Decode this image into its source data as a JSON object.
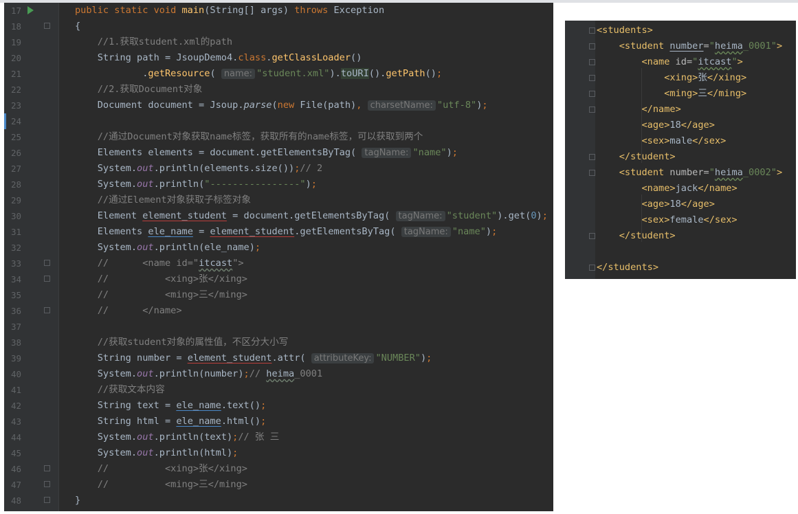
{
  "editor": {
    "lines": [
      {
        "n": "17",
        "segs": [
          [
            "kw",
            "public static void "
          ],
          [
            "fn",
            "main"
          ],
          [
            "",
            "(String[] args) "
          ],
          [
            "kw",
            "throws "
          ],
          [
            "",
            "Exception"
          ]
        ]
      },
      {
        "n": "18",
        "segs": [
          [
            "",
            "{"
          ]
        ]
      },
      {
        "n": "19",
        "segs": [
          [
            "",
            "    "
          ],
          [
            "cm",
            "//1.获取student.xml的path"
          ]
        ]
      },
      {
        "n": "20",
        "segs": [
          [
            "",
            "    String path = JsoupDemo4."
          ],
          [
            "kw",
            "class"
          ],
          [
            "",
            "."
          ],
          [
            "fn",
            "getClassLoader"
          ],
          [
            "",
            "()"
          ]
        ]
      },
      {
        "n": "21",
        "segs": [
          [
            "",
            "            ."
          ],
          [
            "fn",
            "getResource"
          ],
          [
            "",
            "( "
          ],
          [
            "hint",
            "name:"
          ],
          [
            "str",
            "\"student.xml\""
          ],
          [
            "",
            ")."
          ],
          [
            "hl",
            "toURI"
          ],
          [
            "",
            "()."
          ],
          [
            "fn",
            "getPath"
          ],
          [
            "",
            "()"
          ],
          [
            "kw",
            ";"
          ]
        ]
      },
      {
        "n": "22",
        "segs": [
          [
            "",
            "    "
          ],
          [
            "cm",
            "//2.获取Document对象"
          ]
        ]
      },
      {
        "n": "23",
        "segs": [
          [
            "",
            "    Document document = Jsoup."
          ],
          [
            "st",
            "parse"
          ],
          [
            "",
            "("
          ],
          [
            "kw",
            "new "
          ],
          [
            "",
            "File(path)"
          ],
          [
            "kw",
            ", "
          ],
          [
            "hint",
            "charsetName:"
          ],
          [
            "str",
            "\"utf-8\""
          ],
          [
            "",
            ")"
          ],
          [
            "kw",
            ";"
          ]
        ]
      },
      {
        "n": "24",
        "segs": []
      },
      {
        "n": "25",
        "segs": [
          [
            "",
            "    "
          ],
          [
            "cm",
            "//通过Document对象获取name标签，获取所有的name标签，可以获取到两个"
          ]
        ]
      },
      {
        "n": "26",
        "segs": [
          [
            "",
            "    Elements elements = document.getElementsByTag( "
          ],
          [
            "hint",
            "tagName:"
          ],
          [
            "str",
            "\"name\""
          ],
          [
            "",
            ")"
          ],
          [
            "kw",
            ";"
          ]
        ]
      },
      {
        "n": "27",
        "segs": [
          [
            "",
            "    System."
          ],
          [
            "it",
            "out"
          ],
          [
            "",
            ".println(elements.size())"
          ],
          [
            "kw",
            ";"
          ],
          [
            "cm",
            "// 2"
          ]
        ]
      },
      {
        "n": "28",
        "segs": [
          [
            "",
            "    System."
          ],
          [
            "it",
            "out"
          ],
          [
            "",
            ".println("
          ],
          [
            "str",
            "\"----------------\""
          ],
          [
            "",
            ")"
          ],
          [
            "kw",
            ";"
          ]
        ]
      },
      {
        "n": "29",
        "segs": [
          [
            "",
            "    "
          ],
          [
            "cm",
            "//通过Element对象获取子标签对象"
          ]
        ]
      },
      {
        "n": "30",
        "segs": [
          [
            "",
            "    Element "
          ],
          [
            "ur",
            "element_student"
          ],
          [
            "",
            " = document.getElementsByTag( "
          ],
          [
            "hint",
            "tagName:"
          ],
          [
            "str",
            "\"student\""
          ],
          [
            "",
            ").get("
          ],
          [
            "num",
            "0"
          ],
          [
            "",
            ")"
          ],
          [
            "kw",
            ";"
          ]
        ]
      },
      {
        "n": "31",
        "segs": [
          [
            "",
            "    Elements "
          ],
          [
            "ub",
            "ele_name"
          ],
          [
            "",
            " = "
          ],
          [
            "ur",
            "element_student"
          ],
          [
            "",
            ".getElementsByTag( "
          ],
          [
            "hint",
            "tagName:"
          ],
          [
            "str",
            "\"name\""
          ],
          [
            "",
            ")"
          ],
          [
            "kw",
            ";"
          ]
        ]
      },
      {
        "n": "32",
        "segs": [
          [
            "",
            "    System."
          ],
          [
            "it",
            "out"
          ],
          [
            "",
            ".println(ele_name)"
          ],
          [
            "kw",
            ";"
          ]
        ]
      },
      {
        "n": "33",
        "segs": [
          [
            "",
            "    "
          ],
          [
            "cm",
            "//      <name id=\""
          ],
          [
            "wvg",
            "itcast"
          ],
          [
            "cm",
            "\">"
          ]
        ]
      },
      {
        "n": "34",
        "segs": [
          [
            "",
            "    "
          ],
          [
            "cm",
            "//          <xing>张</xing>"
          ]
        ]
      },
      {
        "n": "35",
        "segs": [
          [
            "",
            "    "
          ],
          [
            "cm",
            "//          <ming>三</ming>"
          ]
        ]
      },
      {
        "n": "36",
        "segs": [
          [
            "",
            "    "
          ],
          [
            "cm",
            "//      </name>"
          ]
        ]
      },
      {
        "n": "37",
        "segs": []
      },
      {
        "n": "38",
        "segs": [
          [
            "",
            "    "
          ],
          [
            "cm",
            "//获取student对象的属性值，不区分大小写"
          ]
        ]
      },
      {
        "n": "39",
        "segs": [
          [
            "",
            "    String number = "
          ],
          [
            "ur",
            "element_student"
          ],
          [
            "",
            ".attr( "
          ],
          [
            "hint",
            "attributeKey:"
          ],
          [
            "str",
            "\"NUMBER\""
          ],
          [
            "",
            ")"
          ],
          [
            "kw",
            ";"
          ]
        ]
      },
      {
        "n": "40",
        "segs": [
          [
            "",
            "    System."
          ],
          [
            "it",
            "out"
          ],
          [
            "",
            ".println(number)"
          ],
          [
            "kw",
            ";"
          ],
          [
            "cm",
            "// "
          ],
          [
            "wvg",
            "heima"
          ],
          [
            "cm",
            "_0001"
          ]
        ]
      },
      {
        "n": "41",
        "segs": [
          [
            "",
            "    "
          ],
          [
            "cm",
            "//获取文本内容"
          ]
        ]
      },
      {
        "n": "42",
        "segs": [
          [
            "",
            "    String text = "
          ],
          [
            "ub",
            "ele_name"
          ],
          [
            "",
            ".text()"
          ],
          [
            "kw",
            ";"
          ]
        ]
      },
      {
        "n": "43",
        "segs": [
          [
            "",
            "    String html = "
          ],
          [
            "ub",
            "ele_name"
          ],
          [
            "",
            ".html()"
          ],
          [
            "kw",
            ";"
          ]
        ]
      },
      {
        "n": "44",
        "segs": [
          [
            "",
            "    System."
          ],
          [
            "it",
            "out"
          ],
          [
            "",
            ".println(text)"
          ],
          [
            "kw",
            ";"
          ],
          [
            "cm",
            "// 张 三"
          ]
        ]
      },
      {
        "n": "45",
        "segs": [
          [
            "",
            "    System."
          ],
          [
            "it",
            "out"
          ],
          [
            "",
            ".println(html)"
          ],
          [
            "kw",
            ";"
          ]
        ]
      },
      {
        "n": "46",
        "segs": [
          [
            "",
            "    "
          ],
          [
            "cm",
            "//          <xing>张</xing>"
          ]
        ]
      },
      {
        "n": "47",
        "segs": [
          [
            "",
            "    "
          ],
          [
            "cm",
            "//          <ming>三</ming>"
          ]
        ]
      },
      {
        "n": "48",
        "segs": [
          [
            "",
            "}"
          ]
        ]
      }
    ]
  },
  "xml_panel": {
    "lines": [
      {
        "segs": [
          [
            "tag",
            "<students>"
          ]
        ]
      },
      {
        "segs": [
          [
            "",
            "    "
          ],
          [
            "tag",
            "<student "
          ],
          [
            "au",
            "number"
          ],
          [
            "attr",
            "="
          ],
          [
            "aval",
            "\""
          ],
          [
            "wv",
            "heima"
          ],
          [
            "aval",
            "_0001\""
          ],
          [
            "tag",
            ">"
          ]
        ]
      },
      {
        "segs": [
          [
            "",
            "        "
          ],
          [
            "tag",
            "<name "
          ],
          [
            "attr",
            "id="
          ],
          [
            "aval",
            "\""
          ],
          [
            "wv",
            "itcast"
          ],
          [
            "aval",
            "\""
          ],
          [
            "tag",
            ">"
          ]
        ]
      },
      {
        "segs": [
          [
            "",
            "            "
          ],
          [
            "tag",
            "<xing>"
          ],
          [
            "",
            "张"
          ],
          [
            "tag",
            "</xing>"
          ]
        ]
      },
      {
        "segs": [
          [
            "",
            "            "
          ],
          [
            "tag",
            "<ming>"
          ],
          [
            "",
            "三"
          ],
          [
            "tag",
            "</ming>"
          ]
        ]
      },
      {
        "segs": [
          [
            "",
            "        "
          ],
          [
            "tag",
            "</name>"
          ]
        ]
      },
      {
        "segs": [
          [
            "",
            "        "
          ],
          [
            "tag",
            "<age>"
          ],
          [
            "",
            "18"
          ],
          [
            "tag",
            "</age>"
          ]
        ]
      },
      {
        "segs": [
          [
            "",
            "        "
          ],
          [
            "tag",
            "<sex>"
          ],
          [
            "",
            "male"
          ],
          [
            "tag",
            "</sex>"
          ]
        ]
      },
      {
        "segs": [
          [
            "",
            "    "
          ],
          [
            "tag",
            "</student>"
          ]
        ]
      },
      {
        "segs": [
          [
            "",
            "    "
          ],
          [
            "tag",
            "<student "
          ],
          [
            "attr",
            "number="
          ],
          [
            "aval",
            "\""
          ],
          [
            "wv",
            "heima"
          ],
          [
            "aval",
            "_0002\""
          ],
          [
            "tag",
            ">"
          ]
        ]
      },
      {
        "segs": [
          [
            "",
            "        "
          ],
          [
            "tag",
            "<name>"
          ],
          [
            "",
            "jack"
          ],
          [
            "tag",
            "</name>"
          ]
        ]
      },
      {
        "segs": [
          [
            "",
            "        "
          ],
          [
            "tag",
            "<age>"
          ],
          [
            "",
            "18"
          ],
          [
            "tag",
            "</age>"
          ]
        ]
      },
      {
        "segs": [
          [
            "",
            "        "
          ],
          [
            "tag",
            "<sex>"
          ],
          [
            "",
            "female"
          ],
          [
            "tag",
            "</sex>"
          ]
        ]
      },
      {
        "segs": [
          [
            "",
            "    "
          ],
          [
            "tag",
            "</student>"
          ]
        ]
      },
      {
        "segs": []
      },
      {
        "segs": [
          [
            "tag",
            "</students>"
          ]
        ]
      }
    ]
  },
  "colors": {
    "editor_bg": "#2b2b2b",
    "gutter_bg": "#313335",
    "keyword": "#cc7832",
    "method": "#ffc66d",
    "string": "#6a8759",
    "comment": "#808080",
    "xml_tag": "#e8bf6a"
  }
}
